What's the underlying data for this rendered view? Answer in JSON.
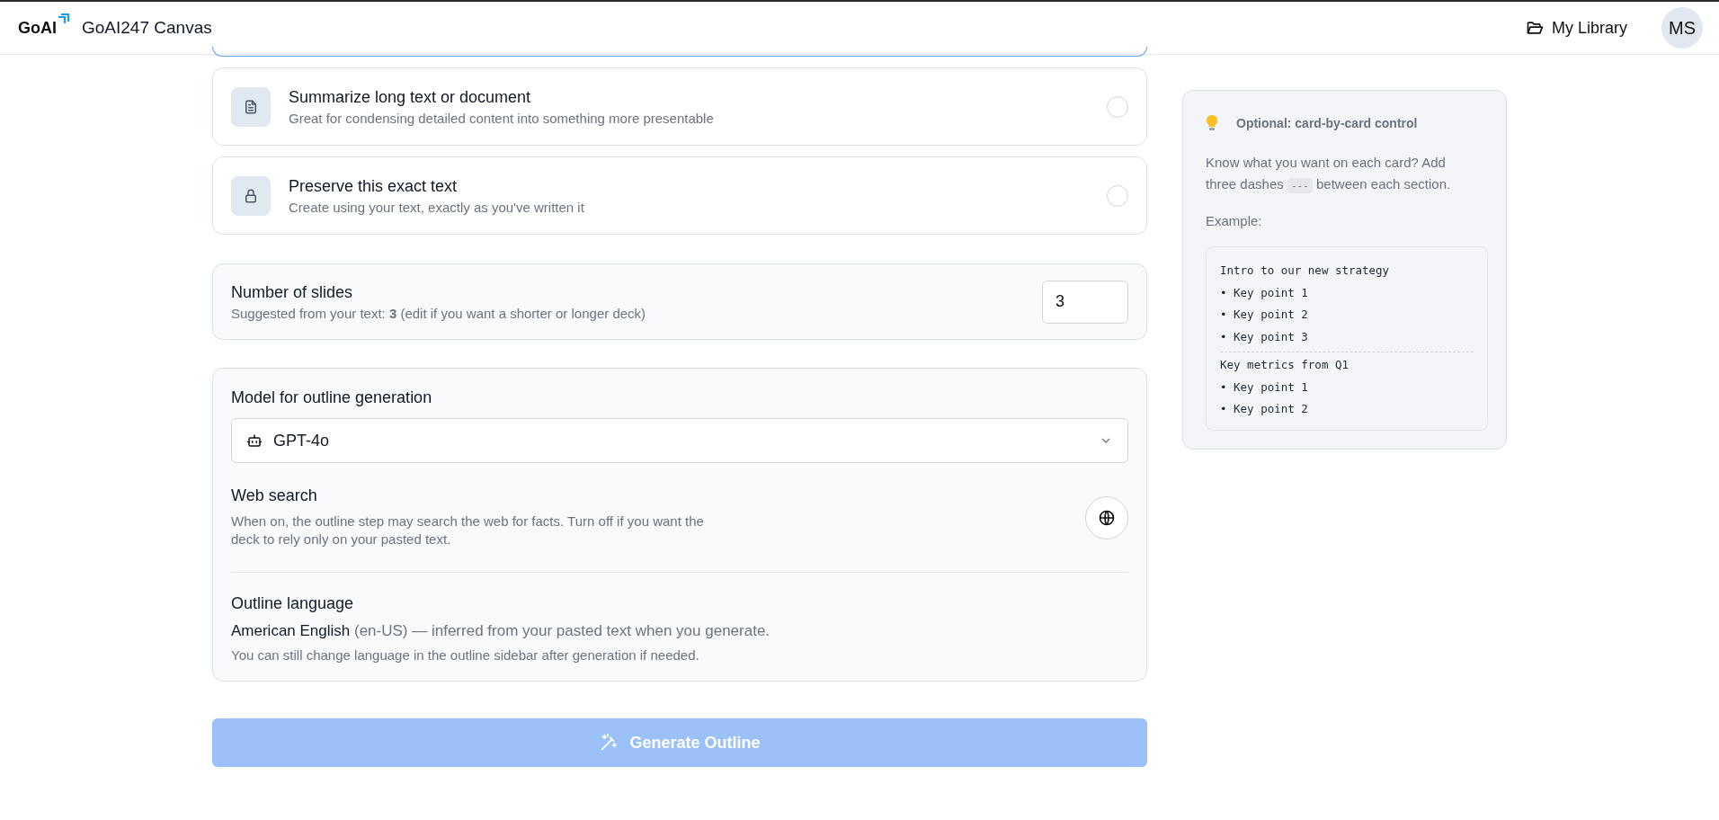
{
  "header": {
    "logo": "GoAI",
    "title": "GoAI247 Canvas",
    "library_link": "My Library",
    "avatar": "MS"
  },
  "options": [
    {
      "title": "Summarize long text or document",
      "description": "Great for condensing detailed content into something more presentable",
      "selected": false
    },
    {
      "title": "Preserve this exact text",
      "description": "Create using your text, exactly as you've written it",
      "selected": false
    }
  ],
  "slides": {
    "label": "Number of slides",
    "hint": "Suggested from your text: **3** (edit if you want a shorter or longer deck)",
    "value": "3"
  },
  "model": {
    "label": "Model for outline generation",
    "value": "GPT-4o"
  },
  "web_search": {
    "label": "Web search",
    "description": "When on, the outline step may search the web for facts. Turn off if you want the deck to rely only on your pasted text."
  },
  "language": {
    "label": "Outline language",
    "detected": "**American English** (en-US) — inferred from your pasted text when you generate.",
    "note": "You can still change language in the outline sidebar after generation if needed."
  },
  "generate_button": {
    "label": "Generate Outline",
    "disabled": true
  },
  "tip": {
    "title": "Optional: card-by-card control",
    "text_before": "Know what you want on each card? Add three dashes",
    "code": "---",
    "text_after": "between each section.",
    "example_label": "Example:",
    "example_sections": [
      {
        "title": "Intro to our new strategy",
        "items": [
          "• Key point 1",
          "• Key point 2",
          "• Key point 3"
        ]
      },
      {
        "title": "Key metrics from Q1",
        "items": [
          "• Key point 1",
          "• Key point 2"
        ]
      }
    ]
  }
}
